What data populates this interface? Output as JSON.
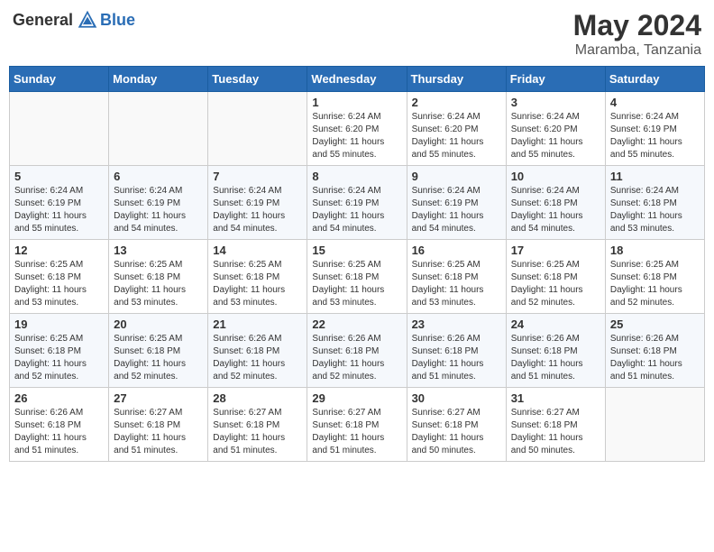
{
  "header": {
    "logo_general": "General",
    "logo_blue": "Blue",
    "month_year": "May 2024",
    "location": "Maramba, Tanzania"
  },
  "weekdays": [
    "Sunday",
    "Monday",
    "Tuesday",
    "Wednesday",
    "Thursday",
    "Friday",
    "Saturday"
  ],
  "weeks": [
    [
      {
        "day": "",
        "info": ""
      },
      {
        "day": "",
        "info": ""
      },
      {
        "day": "",
        "info": ""
      },
      {
        "day": "1",
        "info": "Sunrise: 6:24 AM\nSunset: 6:20 PM\nDaylight: 11 hours and 55 minutes."
      },
      {
        "day": "2",
        "info": "Sunrise: 6:24 AM\nSunset: 6:20 PM\nDaylight: 11 hours and 55 minutes."
      },
      {
        "day": "3",
        "info": "Sunrise: 6:24 AM\nSunset: 6:20 PM\nDaylight: 11 hours and 55 minutes."
      },
      {
        "day": "4",
        "info": "Sunrise: 6:24 AM\nSunset: 6:19 PM\nDaylight: 11 hours and 55 minutes."
      }
    ],
    [
      {
        "day": "5",
        "info": "Sunrise: 6:24 AM\nSunset: 6:19 PM\nDaylight: 11 hours and 55 minutes."
      },
      {
        "day": "6",
        "info": "Sunrise: 6:24 AM\nSunset: 6:19 PM\nDaylight: 11 hours and 54 minutes."
      },
      {
        "day": "7",
        "info": "Sunrise: 6:24 AM\nSunset: 6:19 PM\nDaylight: 11 hours and 54 minutes."
      },
      {
        "day": "8",
        "info": "Sunrise: 6:24 AM\nSunset: 6:19 PM\nDaylight: 11 hours and 54 minutes."
      },
      {
        "day": "9",
        "info": "Sunrise: 6:24 AM\nSunset: 6:19 PM\nDaylight: 11 hours and 54 minutes."
      },
      {
        "day": "10",
        "info": "Sunrise: 6:24 AM\nSunset: 6:18 PM\nDaylight: 11 hours and 54 minutes."
      },
      {
        "day": "11",
        "info": "Sunrise: 6:24 AM\nSunset: 6:18 PM\nDaylight: 11 hours and 53 minutes."
      }
    ],
    [
      {
        "day": "12",
        "info": "Sunrise: 6:25 AM\nSunset: 6:18 PM\nDaylight: 11 hours and 53 minutes."
      },
      {
        "day": "13",
        "info": "Sunrise: 6:25 AM\nSunset: 6:18 PM\nDaylight: 11 hours and 53 minutes."
      },
      {
        "day": "14",
        "info": "Sunrise: 6:25 AM\nSunset: 6:18 PM\nDaylight: 11 hours and 53 minutes."
      },
      {
        "day": "15",
        "info": "Sunrise: 6:25 AM\nSunset: 6:18 PM\nDaylight: 11 hours and 53 minutes."
      },
      {
        "day": "16",
        "info": "Sunrise: 6:25 AM\nSunset: 6:18 PM\nDaylight: 11 hours and 53 minutes."
      },
      {
        "day": "17",
        "info": "Sunrise: 6:25 AM\nSunset: 6:18 PM\nDaylight: 11 hours and 52 minutes."
      },
      {
        "day": "18",
        "info": "Sunrise: 6:25 AM\nSunset: 6:18 PM\nDaylight: 11 hours and 52 minutes."
      }
    ],
    [
      {
        "day": "19",
        "info": "Sunrise: 6:25 AM\nSunset: 6:18 PM\nDaylight: 11 hours and 52 minutes."
      },
      {
        "day": "20",
        "info": "Sunrise: 6:25 AM\nSunset: 6:18 PM\nDaylight: 11 hours and 52 minutes."
      },
      {
        "day": "21",
        "info": "Sunrise: 6:26 AM\nSunset: 6:18 PM\nDaylight: 11 hours and 52 minutes."
      },
      {
        "day": "22",
        "info": "Sunrise: 6:26 AM\nSunset: 6:18 PM\nDaylight: 11 hours and 52 minutes."
      },
      {
        "day": "23",
        "info": "Sunrise: 6:26 AM\nSunset: 6:18 PM\nDaylight: 11 hours and 51 minutes."
      },
      {
        "day": "24",
        "info": "Sunrise: 6:26 AM\nSunset: 6:18 PM\nDaylight: 11 hours and 51 minutes."
      },
      {
        "day": "25",
        "info": "Sunrise: 6:26 AM\nSunset: 6:18 PM\nDaylight: 11 hours and 51 minutes."
      }
    ],
    [
      {
        "day": "26",
        "info": "Sunrise: 6:26 AM\nSunset: 6:18 PM\nDaylight: 11 hours and 51 minutes."
      },
      {
        "day": "27",
        "info": "Sunrise: 6:27 AM\nSunset: 6:18 PM\nDaylight: 11 hours and 51 minutes."
      },
      {
        "day": "28",
        "info": "Sunrise: 6:27 AM\nSunset: 6:18 PM\nDaylight: 11 hours and 51 minutes."
      },
      {
        "day": "29",
        "info": "Sunrise: 6:27 AM\nSunset: 6:18 PM\nDaylight: 11 hours and 51 minutes."
      },
      {
        "day": "30",
        "info": "Sunrise: 6:27 AM\nSunset: 6:18 PM\nDaylight: 11 hours and 50 minutes."
      },
      {
        "day": "31",
        "info": "Sunrise: 6:27 AM\nSunset: 6:18 PM\nDaylight: 11 hours and 50 minutes."
      },
      {
        "day": "",
        "info": ""
      }
    ]
  ]
}
